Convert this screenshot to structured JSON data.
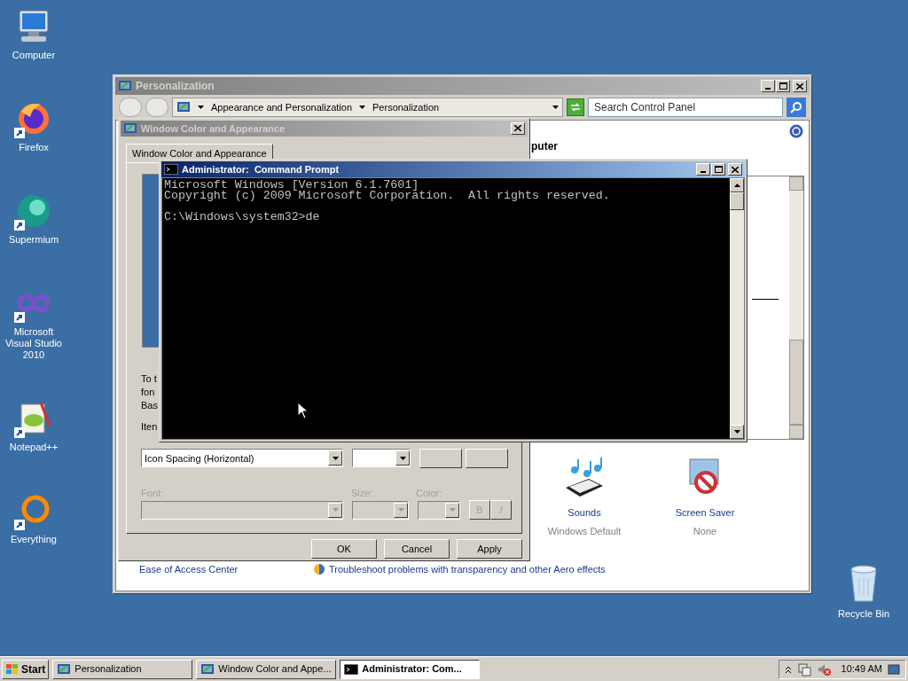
{
  "desktop_icons": [
    {
      "label": "Computer",
      "kind": "computer"
    },
    {
      "label": "Firefox",
      "kind": "firefox"
    },
    {
      "label": "Supermium",
      "kind": "supermium"
    },
    {
      "label": "Microsoft Visual Studio 2010",
      "kind": "vs"
    },
    {
      "label": "Notepad++",
      "kind": "notepad"
    },
    {
      "label": "Everything",
      "kind": "everything"
    }
  ],
  "recycle_bin": {
    "label": "Recycle Bin"
  },
  "personalization": {
    "title": "Personalization",
    "breadcrumb": [
      "Appearance and Personalization",
      "Personalization"
    ],
    "search": {
      "placeholder": "Search Control Panel"
    },
    "heading": "puter",
    "items": [
      {
        "label": "Sounds",
        "value": "Windows Default",
        "kind": "sounds"
      },
      {
        "label": "Screen Saver",
        "value": "None",
        "kind": "screensaver"
      }
    ],
    "see_also": "Ease of Access Center",
    "link": "Troubleshoot problems with transparency and other Aero effects"
  },
  "dialog": {
    "title": "Window Color and Appearance",
    "tab": {
      "label": "Window Color and Appearance",
      "selected": true
    },
    "text_lines": [
      "To t",
      "fon",
      "Bas"
    ],
    "item_label": "Iten",
    "item_value": "Icon Spacing (Horizontal)",
    "font_label": "Font:",
    "size_label": "Size:",
    "color_label": "Color:",
    "bold": "B",
    "italic": "I",
    "buttons": [
      "OK",
      "Cancel",
      "Apply"
    ]
  },
  "console": {
    "title": "Administrator:  Command Prompt",
    "lines": [
      "Microsoft Windows [Version 6.1.7601]",
      "Copyright (c) 2009 Microsoft Corporation.  All rights reserved."
    ],
    "prompt": "C:\\Windows\\system32>de"
  },
  "taskbar": {
    "start": "Start",
    "tasks": [
      {
        "label": "Personalization",
        "selected": false,
        "kind": "cpl"
      },
      {
        "label": "Window Color and Appe...",
        "selected": false,
        "kind": "cpl"
      },
      {
        "label": "Administrator:  Com...",
        "selected": true,
        "kind": "cmd"
      }
    ],
    "clock": "10:49 AM"
  }
}
